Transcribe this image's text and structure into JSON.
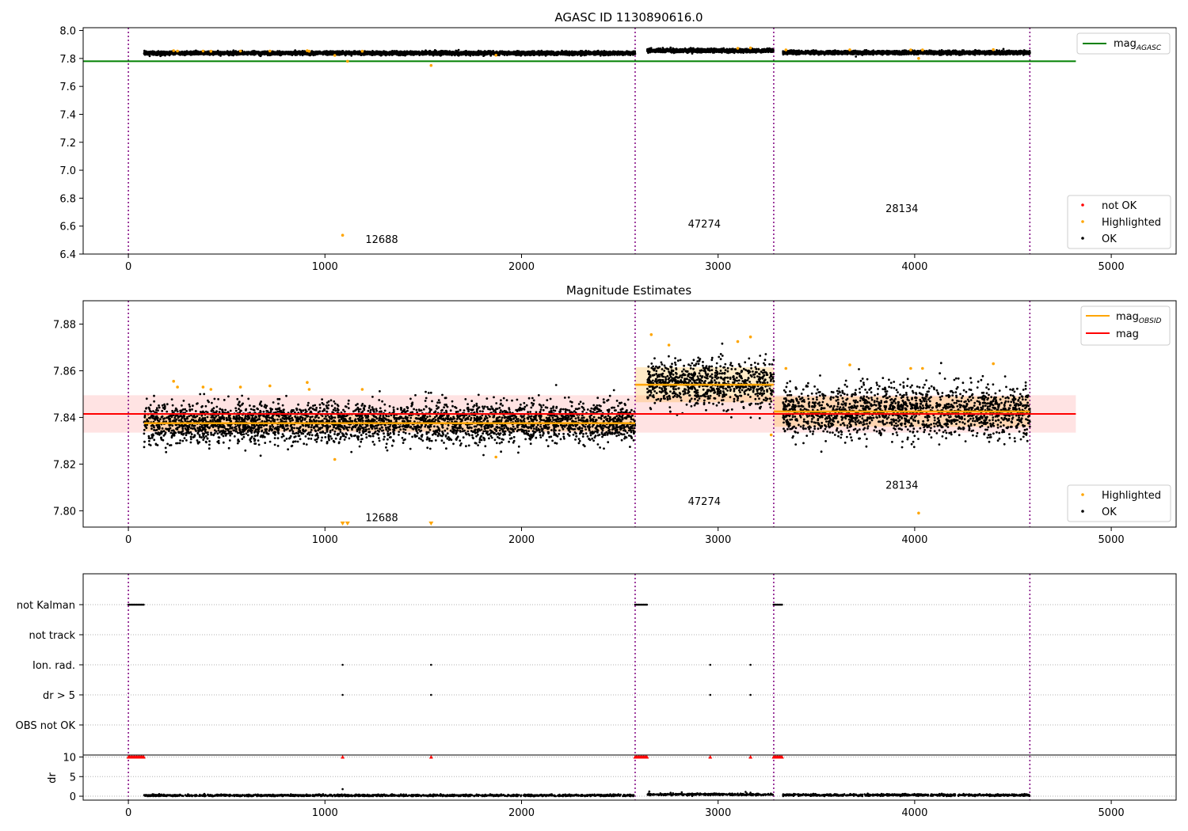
{
  "chart_data": [
    {
      "type": "scatter",
      "title": "AGASC ID 1130890616.0",
      "xlim": [
        -230,
        5330
      ],
      "ylim": [
        6.4,
        8.02
      ],
      "xticks": [
        0,
        1000,
        2000,
        3000,
        4000,
        5000
      ],
      "yticks": [
        6.4,
        6.6,
        6.8,
        7.0,
        7.2,
        7.4,
        7.6,
        7.8,
        8.0
      ],
      "grid": false,
      "obsid_boundaries": [
        0,
        2578,
        3283,
        4586
      ],
      "obsid_labels": [
        {
          "text": "12688",
          "x": 1289,
          "y": 6.48
        },
        {
          "text": "47274",
          "x": 2930,
          "y": 6.59
        },
        {
          "text": "28134",
          "x": 3935,
          "y": 6.7
        }
      ],
      "segments": [
        {
          "x_start": 80,
          "x_end": 2578,
          "mean": 7.838,
          "spread": 0.006
        },
        {
          "x_start": 2640,
          "x_end": 3283,
          "mean": 7.856,
          "spread": 0.006
        },
        {
          "x_start": 3330,
          "x_end": 4586,
          "mean": 7.842,
          "spread": 0.006
        }
      ],
      "lines": [
        {
          "name": "mag_AGASC",
          "color": "#008000",
          "x": [
            -230,
            4820
          ],
          "y": [
            7.78,
            7.78
          ]
        }
      ],
      "highlighted": {
        "x": [
          230,
          250,
          380,
          420,
          570,
          720,
          910,
          920,
          1050,
          1090,
          1115,
          1190,
          1540,
          1870,
          3100,
          3165,
          3345,
          3670,
          3980,
          4020,
          4040,
          4400
        ],
        "y": [
          7.856,
          7.853,
          7.853,
          7.852,
          7.853,
          7.853,
          7.855,
          7.852,
          7.822,
          6.535,
          7.78,
          7.852,
          7.75,
          7.823,
          7.873,
          7.875,
          7.861,
          7.862,
          7.861,
          7.8,
          7.861,
          7.863
        ]
      },
      "legends": [
        {
          "position": "upper-right",
          "entries": [
            {
              "label_base": "mag",
              "label_sub": "AGASC",
              "color": "#008000",
              "marker": "line"
            }
          ]
        },
        {
          "position": "lower-right",
          "entries": [
            {
              "label": "not OK",
              "color": "#ff0000",
              "marker": "dot"
            },
            {
              "label": "Highlighted",
              "color": "#ffa500",
              "marker": "dot"
            },
            {
              "label": "OK",
              "color": "#000000",
              "marker": "dot"
            }
          ]
        }
      ]
    },
    {
      "type": "scatter",
      "title": "Magnitude Estimates",
      "xlim": [
        -230,
        5330
      ],
      "ylim": [
        7.793,
        7.89
      ],
      "xticks": [
        0,
        1000,
        2000,
        3000,
        4000,
        5000
      ],
      "yticks": [
        7.8,
        7.82,
        7.84,
        7.86,
        7.88
      ],
      "ytick_labels": [
        "7.80",
        "7.82",
        "7.84",
        "7.86",
        "7.88"
      ],
      "grid": false,
      "obsid_boundaries": [
        0,
        2578,
        3283,
        4586
      ],
      "obsid_labels": [
        {
          "text": "12688",
          "x": 1289,
          "y": 7.7955
        },
        {
          "text": "47274",
          "x": 2930,
          "y": 7.8025
        },
        {
          "text": "28134",
          "x": 3935,
          "y": 7.8095
        }
      ],
      "mag_mean": 7.8415,
      "mag_band": [
        7.8335,
        7.8495
      ],
      "mag_x": [
        -230,
        4820
      ],
      "obsid_means": [
        {
          "x_start": 80,
          "x_end": 2578,
          "mean": 7.8375,
          "lo": 7.834,
          "hi": 7.841
        },
        {
          "x_start": 2578,
          "x_end": 3283,
          "mean": 7.854,
          "lo": 7.8465,
          "hi": 7.8615
        },
        {
          "x_start": 3283,
          "x_end": 4586,
          "mean": 7.8425,
          "lo": 7.836,
          "hi": 7.849
        }
      ],
      "segments": [
        {
          "x_start": 80,
          "x_end": 2578,
          "mean": 7.8378,
          "spread": 0.0042
        },
        {
          "x_start": 2640,
          "x_end": 3283,
          "mean": 7.8545,
          "spread": 0.0048
        },
        {
          "x_start": 3330,
          "x_end": 4586,
          "mean": 7.8425,
          "spread": 0.0055
        }
      ],
      "highlighted": {
        "x": [
          230,
          250,
          380,
          420,
          570,
          720,
          910,
          920,
          1050,
          1190,
          1870,
          2660,
          2750,
          3100,
          3165,
          3270,
          3345,
          3670,
          3980,
          4020,
          4040,
          4400
        ],
        "y": [
          7.8555,
          7.853,
          7.853,
          7.852,
          7.853,
          7.8535,
          7.855,
          7.852,
          7.822,
          7.852,
          7.823,
          7.8755,
          7.871,
          7.8725,
          7.8745,
          7.8325,
          7.861,
          7.8625,
          7.861,
          7.799,
          7.861,
          7.863
        ]
      },
      "highlighted_offscale_x": [
        1090,
        1115,
        1540
      ],
      "legends": [
        {
          "position": "upper-right",
          "entries": [
            {
              "label_base": "mag",
              "label_sub": "OBSID",
              "color": "#ffa500",
              "marker": "line"
            },
            {
              "label": "mag",
              "color": "#ff0000",
              "marker": "line"
            }
          ]
        },
        {
          "position": "lower-right",
          "entries": [
            {
              "label": "Highlighted",
              "color": "#ffa500",
              "marker": "dot"
            },
            {
              "label": "OK",
              "color": "#000000",
              "marker": "dot"
            }
          ]
        }
      ]
    },
    {
      "type": "scatter",
      "xlim": [
        -230,
        5330
      ],
      "obsid_boundaries": [
        0,
        2578,
        3283,
        4586
      ],
      "flag_rows": [
        "not Kalman",
        "not track",
        "Ion. rad.",
        "dr > 5",
        "OBS not OK"
      ],
      "flag_points": [
        {
          "row": "not Kalman",
          "ranges": [
            [
              0,
              80
            ],
            [
              2578,
              2640
            ],
            [
              3283,
              3330
            ]
          ]
        },
        {
          "row": "Ion. rad.",
          "x": [
            1090,
            1540,
            2960,
            3165
          ]
        },
        {
          "row": "dr > 5",
          "x": [
            1090,
            1540,
            2960,
            3165
          ]
        }
      ],
      "dr": {
        "ylabel": "dr",
        "ylim": [
          -1,
          10.5
        ],
        "yticks": [
          0,
          5,
          10
        ],
        "capped_value": 10,
        "capped_ranges": [
          [
            0,
            80
          ],
          [
            2578,
            2640
          ],
          [
            3283,
            3330
          ]
        ],
        "capped_x": [
          1090,
          1540,
          2960,
          3165
        ],
        "segments": [
          {
            "x_start": 80,
            "x_end": 2578,
            "level": 0.2
          },
          {
            "x_start": 2640,
            "x_end": 3283,
            "level": 0.45
          },
          {
            "x_start": 3330,
            "x_end": 4586,
            "level": 0.3
          }
        ],
        "outliers": {
          "x": [
            1090,
            2650,
            2815,
            3140,
            3165
          ],
          "y": [
            1.8,
            1.2,
            1.0,
            1.1,
            0.9
          ]
        }
      }
    }
  ]
}
